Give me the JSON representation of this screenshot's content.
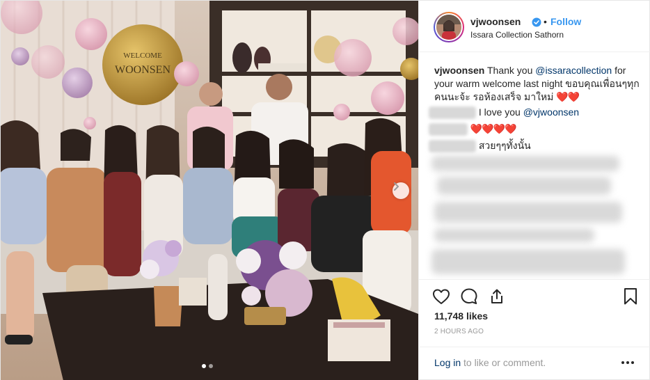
{
  "post": {
    "username": "vjwoonsen",
    "follow_label": "Follow",
    "separator": "•",
    "location": "Issara Collection Sathorn",
    "balloon_text": {
      "line1": "WELCOME",
      "line2": "WOONSEN"
    },
    "caption": {
      "username": "vjwoonsen",
      "text_before": " Thank you ",
      "mention": "@issaracollection",
      "text_after": " for your warm welcome last night ขอบคุณเพื่อนๆทุกคนนะจ้ะ รอห้องเสร็จ มาใหม่ ",
      "emoji": "❤️❤️"
    },
    "comments": [
      {
        "text": "I love you ",
        "mention": "@vjwoonsen"
      },
      {
        "text": "",
        "emoji": "❤️❤️❤️❤️"
      },
      {
        "text": "สวยๆๆทั้งนั้น"
      }
    ],
    "likes": "11,748 likes",
    "time": "2 HOURS AGO",
    "login_link": "Log in",
    "login_rest": " to like or comment.",
    "icons": {
      "like": "heart-icon",
      "comment": "comment-bubble-icon",
      "share": "share-icon",
      "save": "bookmark-icon",
      "more": "more-options-icon",
      "next": "chevron-right-icon",
      "verified": "verified-badge-icon"
    },
    "colors": {
      "link": "#003569",
      "follow": "#3897f0",
      "verified": "#3897f0",
      "heart": "#e0162b"
    }
  }
}
